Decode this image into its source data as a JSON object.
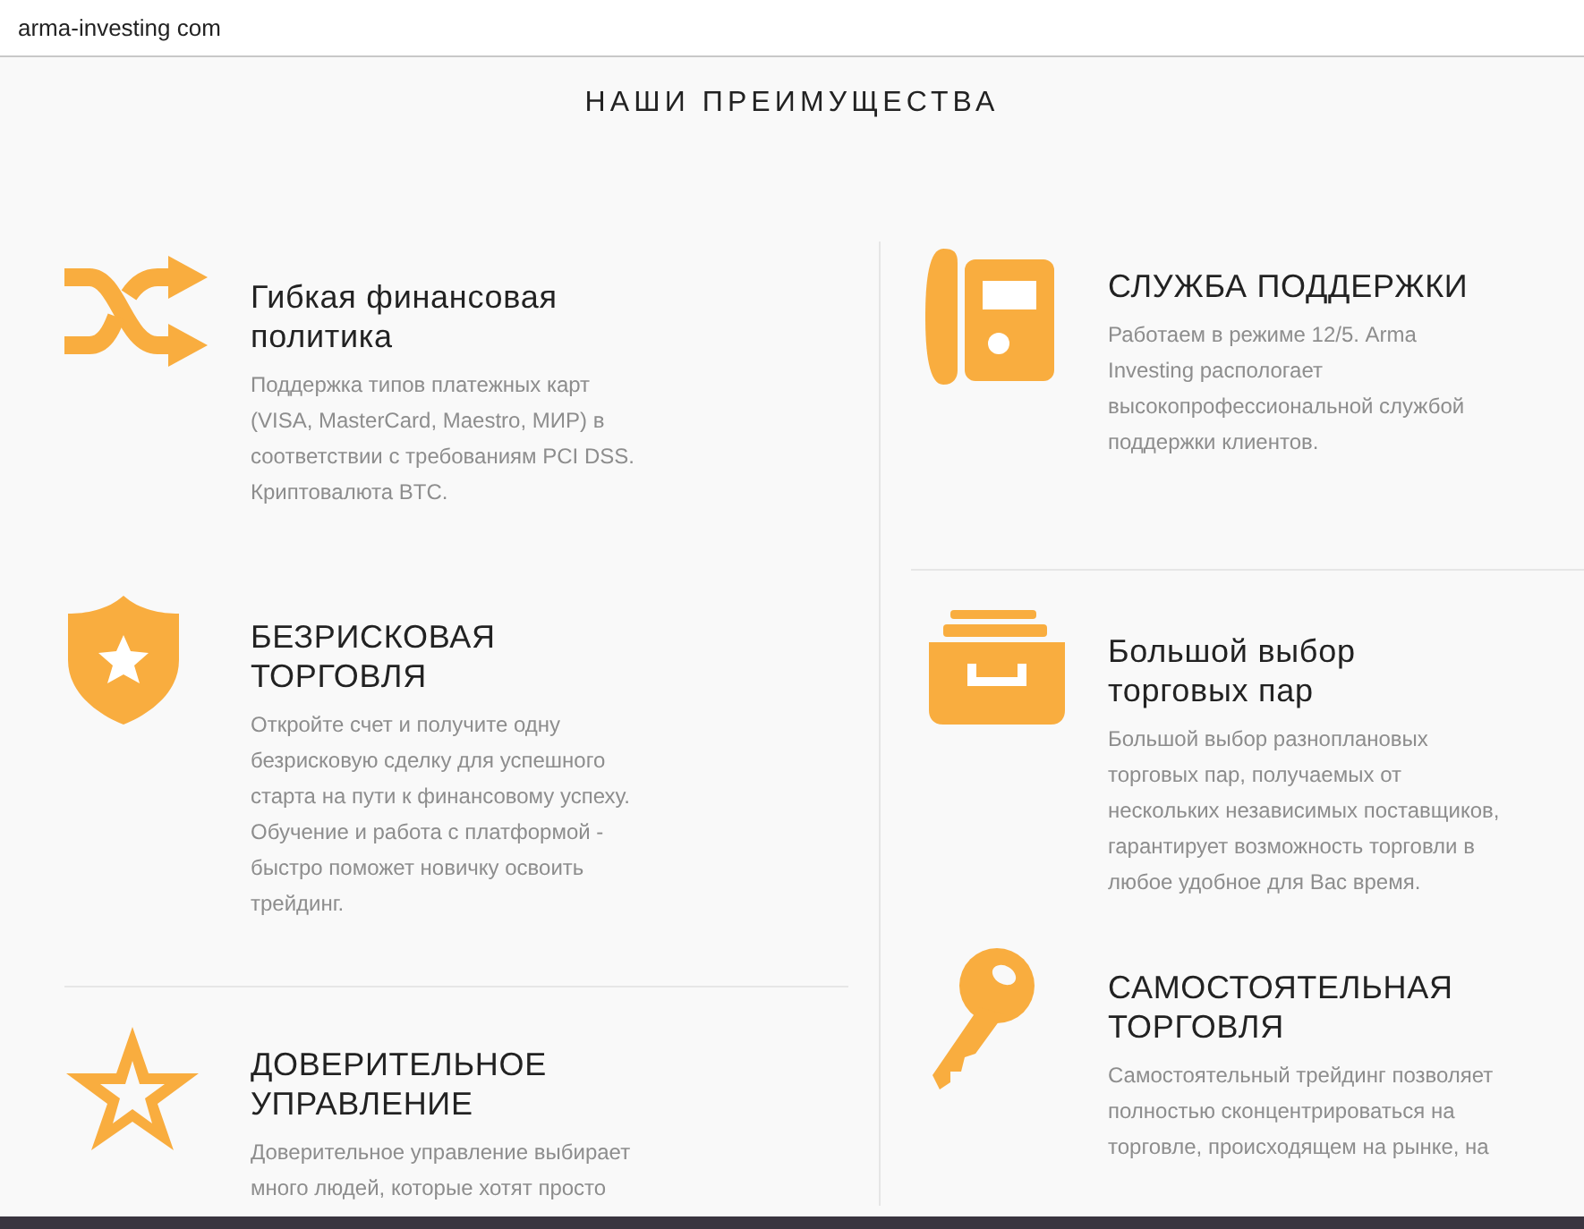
{
  "address_bar": {
    "url": "arma-investing com"
  },
  "section_title": "НАШИ ПРЕИМУЩЕСТВА",
  "columns": [
    {
      "items": [
        {
          "title": "Гибкая финансовая политика",
          "description": "Поддержка типов платежных карт (VISA, MasterCard, Maestro, МИР) в соответствии с требованиям PCI DSS. Криптовалюта BTC."
        },
        {
          "title": "БЕЗРИСКОВАЯ ТОРГОВЛЯ",
          "description": "Откройте счет и получите одну безрисковую сделку для успешного старта на пути к финансовому успеху. Обучение и работа с платформой - быстро поможет новичку освоить трейдинг."
        },
        {
          "title": "ДОВЕРИТЕЛЬНОЕ УПРАВЛЕНИЕ",
          "description": "Доверительное управление выбирает много людей, которые хотят просто"
        }
      ]
    },
    {
      "items": [
        {
          "title": "СЛУЖБА ПОДДЕРЖКИ",
          "description": "Работаем в режиме 12/5. Arma Investing распологает высокопрофессиональной службой поддержки клиентов."
        },
        {
          "title": "Большой выбор торговых пар",
          "description": "Большой выбор разноплановых торговых пар, получаемых от нескольких независимых поставщиков, гарантирует возможность торговли в любое удобное для Вас время."
        },
        {
          "title": "САМОСТОЯТЕЛЬНАЯ ТОРГОВЛЯ",
          "description": "Самостоятельный трейдинг позволяет полностью сконцентрироваться на торговле, происходящем на рынке, на"
        }
      ]
    }
  ]
}
